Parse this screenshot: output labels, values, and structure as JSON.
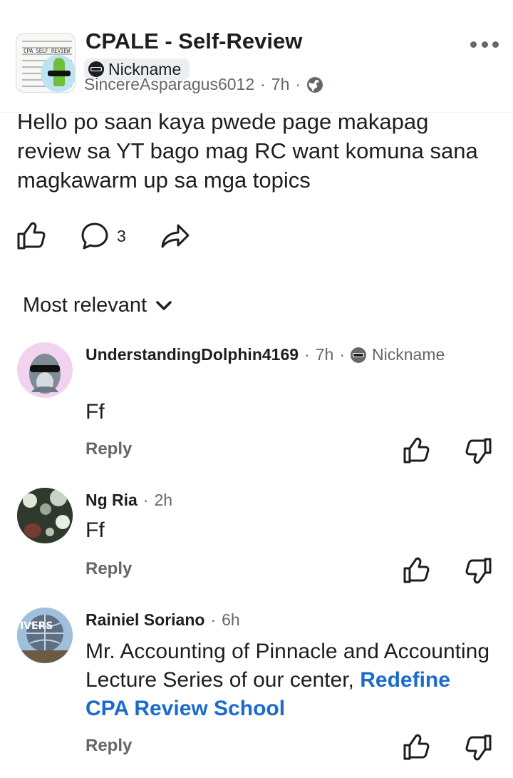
{
  "post": {
    "group_name": "CPALE - Self-Review",
    "nickname_label": "Nickname",
    "author": "SincereAsparagus6012",
    "time": "7h",
    "separator": "·",
    "body": "Hello po saan kaya pwede page makapag review sa YT bago mag RC want komuna sana magkawarm up sa mga topics",
    "comment_count": "3",
    "avatar_caption": "CPA SELF REVIEW"
  },
  "sort": {
    "label": "Most relevant"
  },
  "comments": [
    {
      "author": "UnderstandingDolphin4169",
      "time": "7h",
      "badge": "Nickname",
      "text": "Ff",
      "reply_label": "Reply"
    },
    {
      "author": "Ng Ria",
      "time": "2h",
      "text": "Ff",
      "reply_label": "Reply"
    },
    {
      "author": "Rainiel Soriano",
      "time": "6h",
      "text": "Mr. Accounting of Pinnacle and Accounting Lecture Series of our center, ",
      "link_text": "Redefine CPA Review School",
      "reply_label": "Reply",
      "avatar_caption": "IVERS"
    }
  ],
  "icons": {
    "more": "more-icon",
    "globe": "globe-icon",
    "like": "thumbs-up-icon",
    "comment": "comment-bubble-icon",
    "share": "share-arrow-icon",
    "chevron": "chevron-down-icon",
    "upvote": "thumbs-up-icon",
    "downvote": "thumbs-down-icon"
  },
  "colors": {
    "text": "#1c1e21",
    "muted": "#65676b",
    "link": "#1a6bcc"
  }
}
